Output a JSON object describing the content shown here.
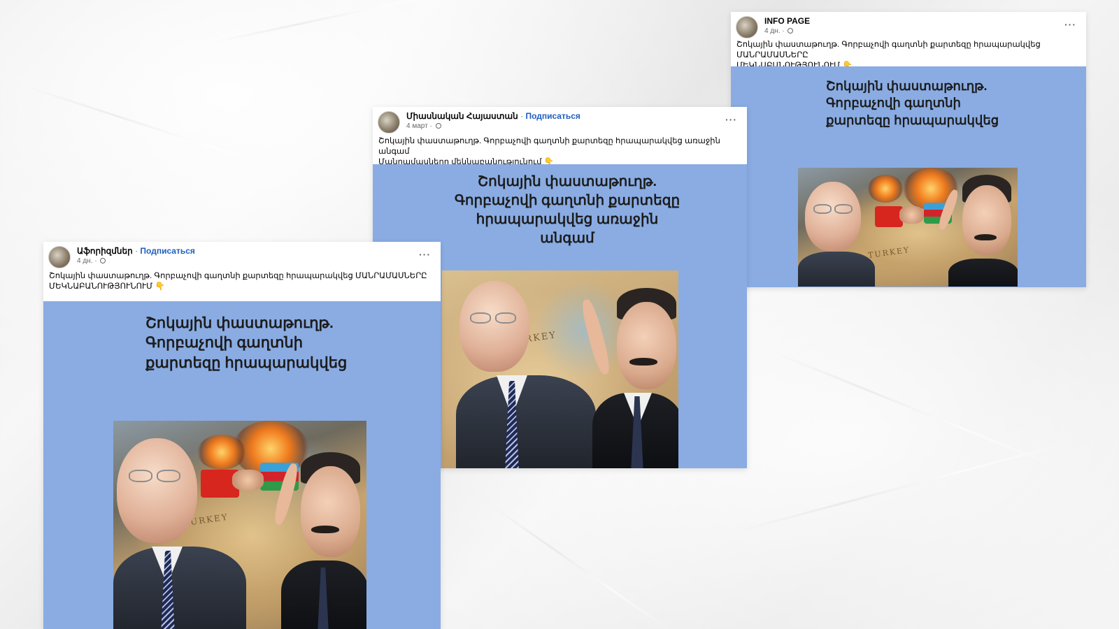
{
  "posts": [
    {
      "author": "Աֆորիզմներ",
      "separator": "·",
      "follow_label": "Подписаться",
      "time": "4 дн.",
      "more_label": "···",
      "caption_line1": "Շոկային փաստաթուղթ. Գորբաչովի գաղտնի քարտեզը հրապարակվեց   ՄԱՆՐԱՄԱՍՆԵՐԸ",
      "caption_line2": "ՄԵԿՆԱԲԱՆՈՒԹՅՈՒՆՈՒՄ",
      "hand_icon": "👇",
      "image_title_lines": [
        "Շոկային փաստաթուղթ.",
        "Գորբաչովի գաղտնի",
        "քարտեզը հրապարակվեց"
      ],
      "map_label": "TURKEY"
    },
    {
      "author": "Միասնական Հայաստան",
      "separator": "·",
      "follow_label": "Подписаться",
      "time": "4 март",
      "more_label": "···",
      "caption_line1": "Շոկային փաստաթուղթ. Գորբաչովի գաղտնի քարտեզը հրապարակվեց առաջին անգամ",
      "caption_line2": "Մանրամասները մեկնաբանությունում",
      "hand_icon": "👇",
      "image_title_lines": [
        "Շոկային փաստաթուղթ.",
        "Գորբաչովի գաղտնի քարտեզը",
        "հրապարակվեց առաջին անգամ"
      ],
      "map_label": "TURKEY"
    },
    {
      "author": "INFO PAGE",
      "separator": "",
      "follow_label": "",
      "time": "4 дн.",
      "more_label": "···",
      "caption_line1": "Շոկային փաստաթուղթ. Գորբաչովի գաղտնի քարտեզը հրապարակվեց   ՄԱՆՐԱՄԱՍՆԵՐԸ",
      "caption_line2": "ՄԵԿՆԱԲԱՆՈՒԹՅՈՒՆՈՒՄ",
      "hand_icon": "👇",
      "image_title_lines": [
        "Շոկային փաստաթուղթ.",
        "Գորբաչովի գաղտնի",
        "քարտեզը հրապարակվեց"
      ],
      "map_label": "TURKEY"
    }
  ],
  "colors": {
    "image_background": "#8aace3",
    "follow_link": "#1f5fbf",
    "meta_text": "#65676b"
  },
  "icons": [
    "avatar",
    "globe-icon",
    "more-options-icon",
    "pointing-down-hand-icon"
  ]
}
